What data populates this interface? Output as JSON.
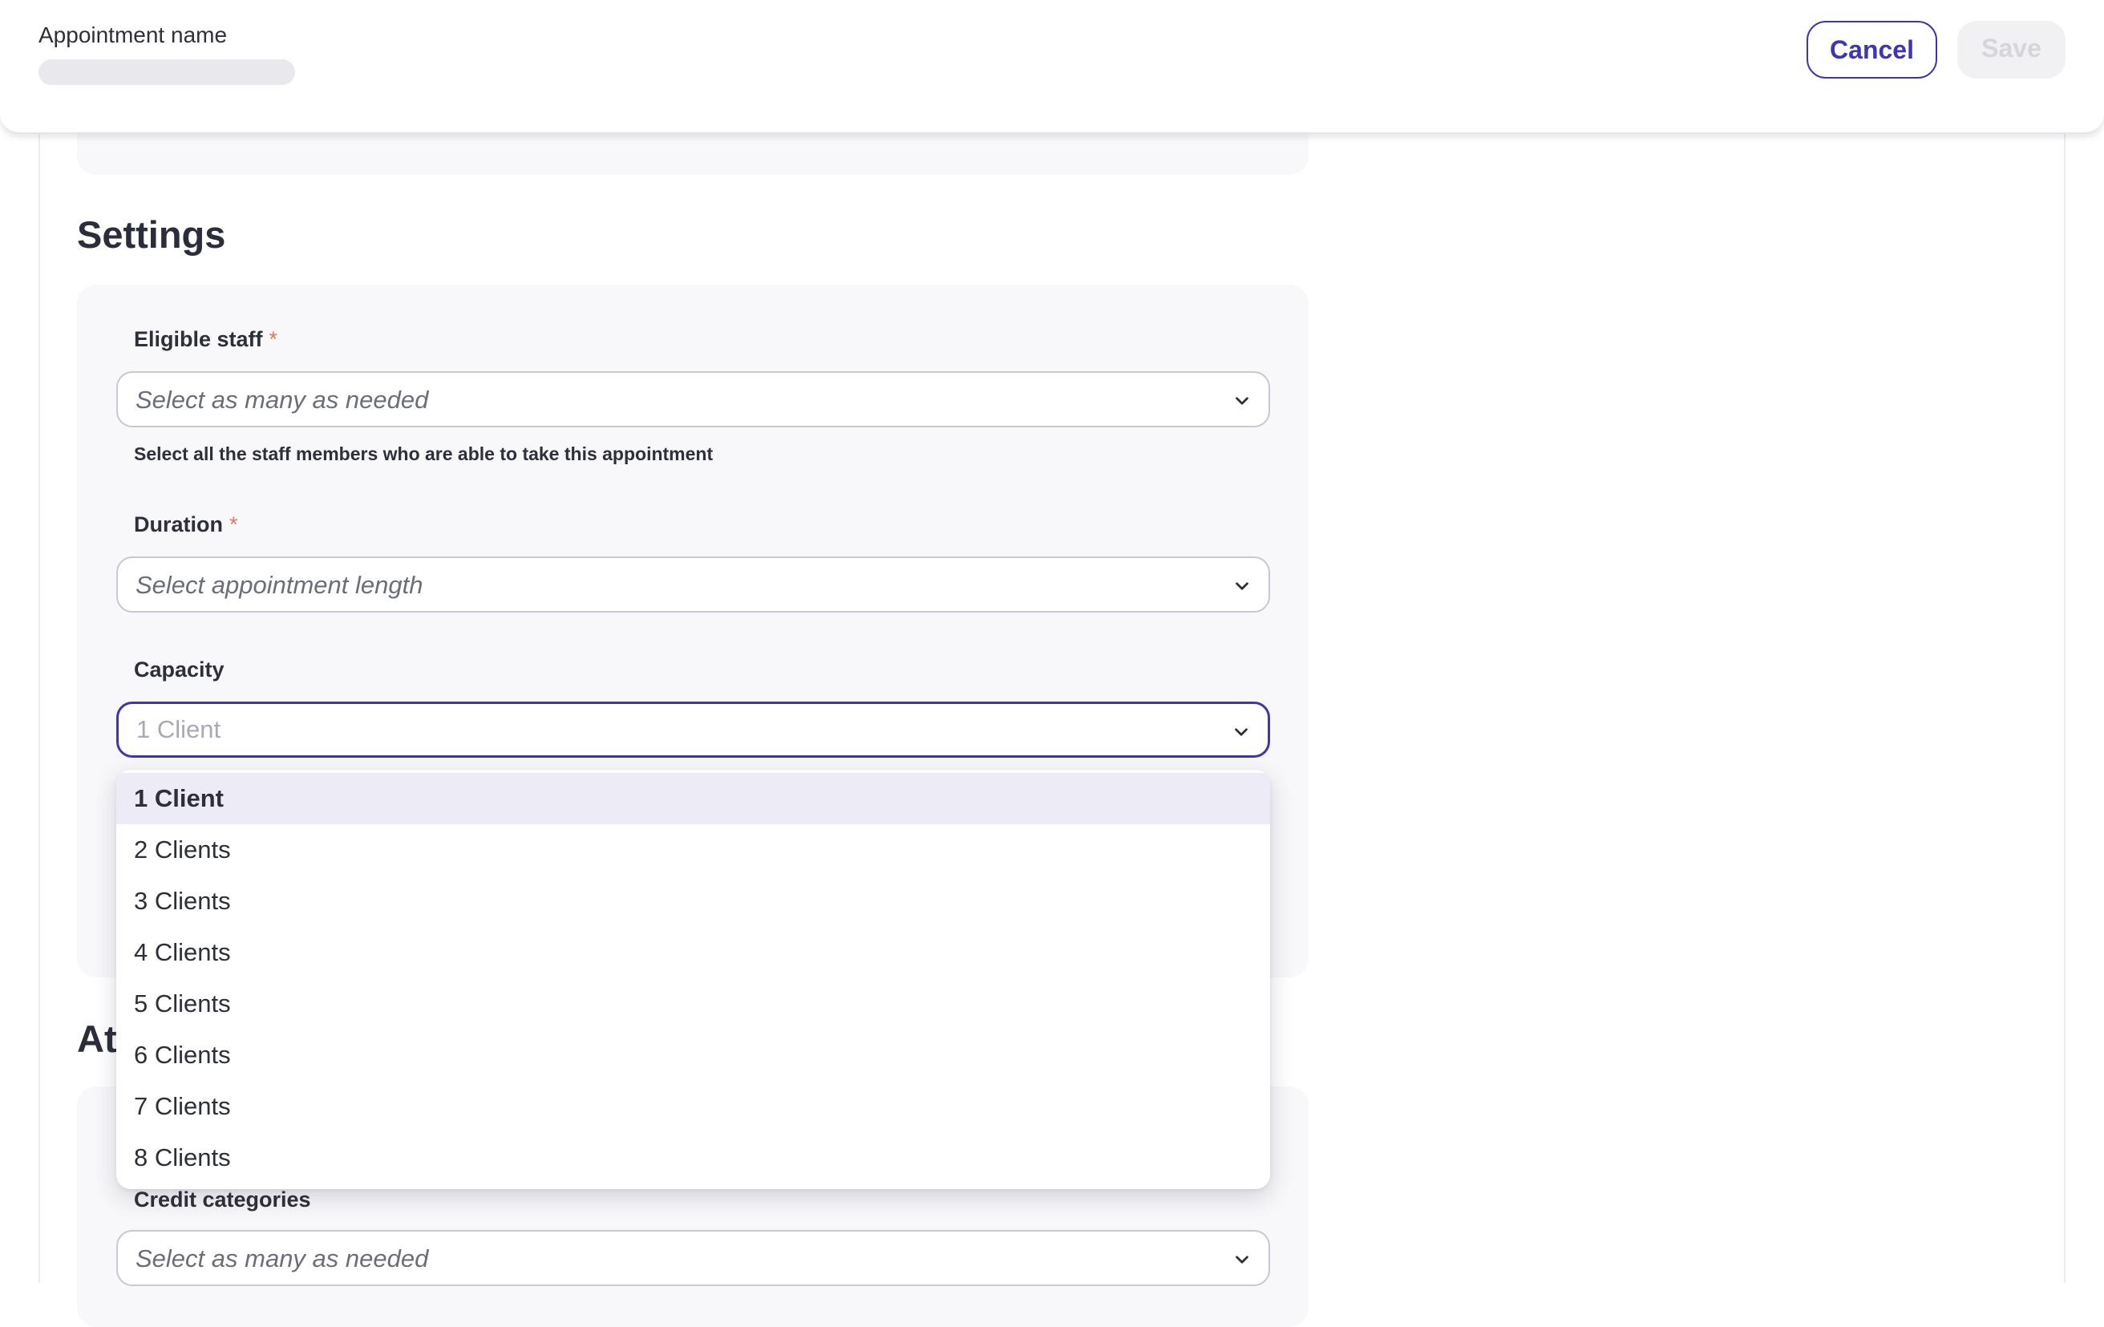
{
  "header": {
    "name_label": "Appointment name",
    "cancel_label": "Cancel",
    "save_label": "Save"
  },
  "settings": {
    "title": "Settings",
    "eligible_staff": {
      "label": "Eligible staff",
      "required_mark": "*",
      "placeholder": "Select as many as needed",
      "help": "Select all the staff members who are able to take this appointment"
    },
    "duration": {
      "label": "Duration",
      "required_mark": "*",
      "placeholder": "Select appointment length"
    },
    "capacity": {
      "label": "Capacity",
      "value": "1 Client",
      "options": [
        "1 Client",
        "2 Clients",
        "3 Clients",
        "4 Clients",
        "5 Clients",
        "6 Clients",
        "7 Clients",
        "8 Clients"
      ],
      "selected_index": 0
    }
  },
  "attributes": {
    "title_partial": "At",
    "credit_categories": {
      "label": "Credit categories",
      "placeholder": "Select as many as needed"
    }
  },
  "colors": {
    "accent": "#3d36b3",
    "required": "#e07a5f",
    "card_bg": "#f8f8fa",
    "selected_option_bg": "#ecebf6"
  },
  "icons": {
    "select_chevron": "chevron-down-icon"
  }
}
